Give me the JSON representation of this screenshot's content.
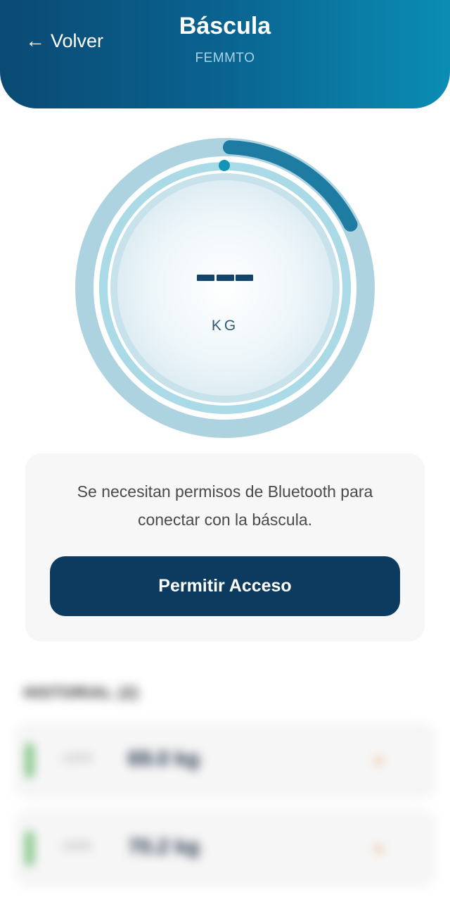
{
  "header": {
    "back_label": "Volver",
    "back_icon": "arrow-left-icon",
    "title": "Báscula",
    "subtitle": "FEMMTO"
  },
  "scale": {
    "unit": "KG",
    "progress_fraction": 0.17,
    "colors": {
      "outer_ring": "#aed3e0",
      "inner_ring": "#a9dae6",
      "progress_arc": "#1e7ca3",
      "indicator_dot": "#1393b8",
      "weight_dash": "#13456b"
    }
  },
  "permission": {
    "message": "Se necesitan permisos de Bluetooth para conectar con la báscula.",
    "button_label": "Permitir Acceso"
  },
  "history": {
    "title": "HISTORIAL (2)",
    "rows": [
      {
        "date": "12/05",
        "weight": "69.0 kg",
        "trend_icon": "trend-icon"
      },
      {
        "date": "10/05",
        "weight": "70.2 kg",
        "trend_icon": "trend-icon"
      }
    ]
  }
}
